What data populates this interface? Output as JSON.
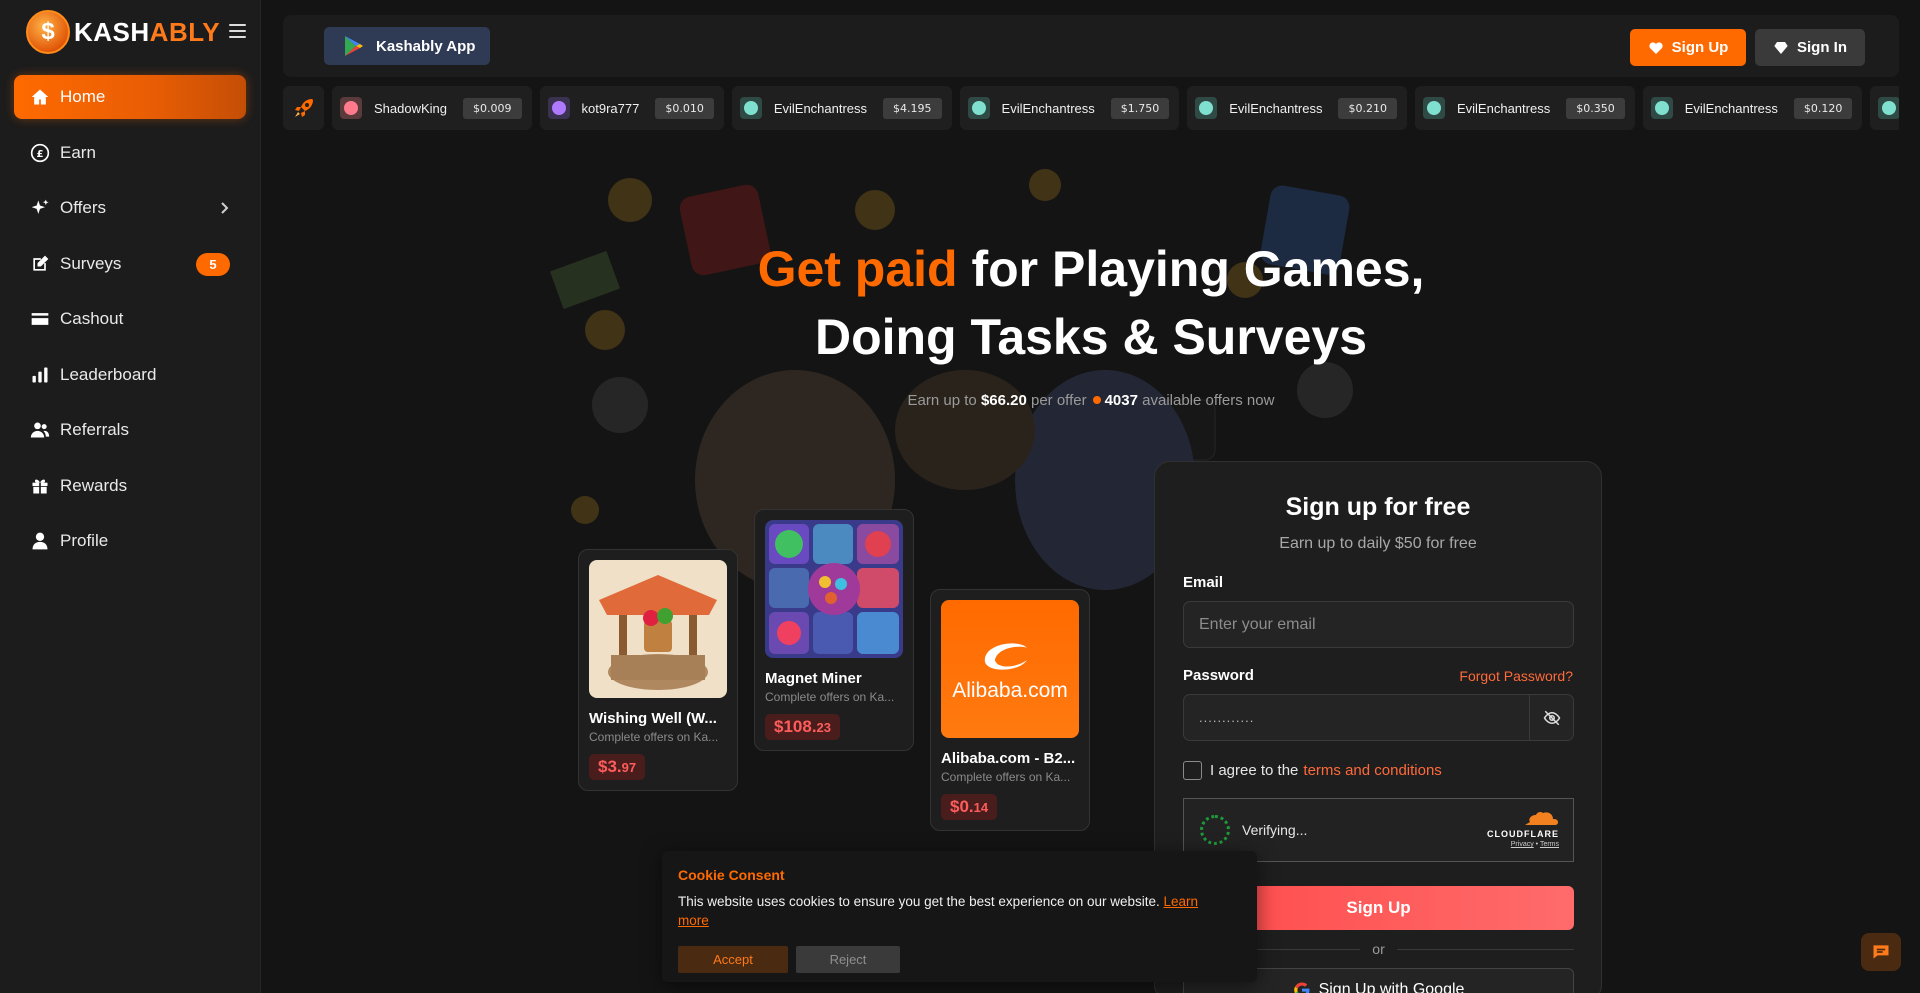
{
  "brand": {
    "name_part1": "KASH",
    "name_part2": "ABLY",
    "mark": "$"
  },
  "sidebar": {
    "items": [
      {
        "label": "Home",
        "icon": "home-icon"
      },
      {
        "label": "Earn",
        "icon": "coin-icon"
      },
      {
        "label": "Offers",
        "icon": "sparkle-icon"
      },
      {
        "label": "Surveys",
        "icon": "pencil-icon",
        "badge": "5"
      },
      {
        "label": "Cashout",
        "icon": "card-icon"
      },
      {
        "label": "Leaderboard",
        "icon": "bar-chart-icon"
      },
      {
        "label": "Referrals",
        "icon": "users-icon"
      },
      {
        "label": "Rewards",
        "icon": "gift-icon"
      },
      {
        "label": "Profile",
        "icon": "user-icon"
      }
    ]
  },
  "header": {
    "app_button": "Kashably App",
    "signup": "Sign Up",
    "signin": "Sign In"
  },
  "ticker": [
    {
      "name": "ShadowKing",
      "amount": "$0.009"
    },
    {
      "name": "kot9ra777",
      "amount": "$0.010"
    },
    {
      "name": "EvilEnchantress",
      "amount": "$4.195"
    },
    {
      "name": "EvilEnchantress",
      "amount": "$1.750"
    },
    {
      "name": "EvilEnchantress",
      "amount": "$0.210"
    },
    {
      "name": "EvilEnchantress",
      "amount": "$0.350"
    },
    {
      "name": "EvilEnchantress",
      "amount": "$0.120"
    }
  ],
  "hero": {
    "title_highlight": "Get paid",
    "title_rest": " for Playing Games,",
    "title_line2": "Doing Tasks & Surveys",
    "sub_prefix": "Earn up to ",
    "sub_amount": "$66.20",
    "sub_mid": " per offer",
    "sub_count": "4037",
    "sub_suffix": " available offers now"
  },
  "offers": [
    {
      "title": "Wishing Well (W...",
      "desc": "Complete offers on Ka...",
      "price_main": "$3.",
      "price_cents": "97"
    },
    {
      "title": "Magnet Miner",
      "desc": "Complete offers on Ka...",
      "price_main": "$108.",
      "price_cents": "23"
    },
    {
      "title": "Alibaba.com - B2...",
      "desc": "Complete offers on Ka...",
      "price_main": "$0.",
      "price_cents": "14",
      "logo_text": "Alibaba.com"
    }
  ],
  "signup_panel": {
    "title": "Sign up for free",
    "subtitle": "Earn up to daily $50 for free",
    "email_label": "Email",
    "email_placeholder": "Enter your email",
    "password_label": "Password",
    "forgot": "Forgot Password?",
    "password_value": "............",
    "agree_text": "I agree to the",
    "terms": "terms and conditions",
    "captcha_status": "Verifying...",
    "captcha_brand": "CLOUDFLARE",
    "captcha_privacy": "Privacy",
    "captcha_terms": "Terms",
    "submit": "Sign Up",
    "or": "or",
    "google": "Sign Up with Google"
  },
  "cookie": {
    "title": "Cookie Consent",
    "text": "This website uses cookies to ensure you get the best experience on our website. ",
    "learn_more": "Learn more",
    "accept": "Accept",
    "reject": "Reject"
  },
  "colors": {
    "accent": "#ff6a00",
    "danger": "#ff4a4a",
    "sidebar_bg": "#1c1c1c",
    "page_bg": "#141414"
  }
}
